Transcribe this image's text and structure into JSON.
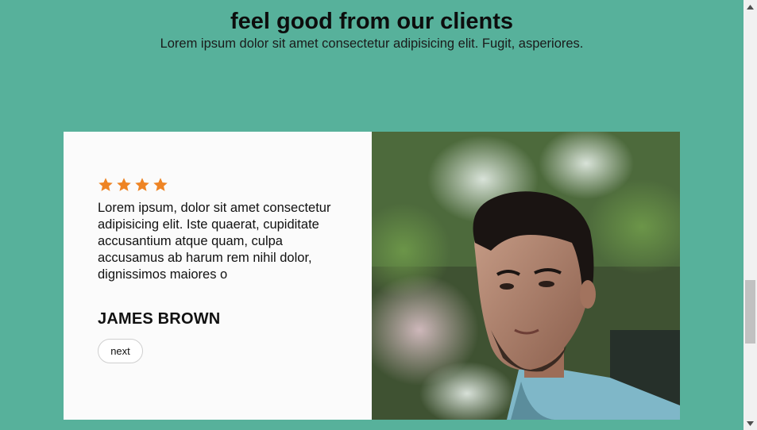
{
  "section": {
    "title": "feel good from our clients",
    "subtitle": "Lorem ipsum dolor sit amet consectetur adipisicing elit. Fugit, asperiores."
  },
  "testimonial": {
    "rating": 4,
    "star_color": "#ee8424",
    "quote": "Lorem ipsum, dolor sit amet consectetur adipisicing elit. Iste quaerat, cupiditate accusantium atque quam, culpa accusamus ab harum rem nihil dolor, dignissimos maiores o",
    "name": "JAMES BROWN",
    "next_label": "next"
  },
  "colors": {
    "page_background": "#57b19b",
    "card_background": "#fbfbfb"
  }
}
